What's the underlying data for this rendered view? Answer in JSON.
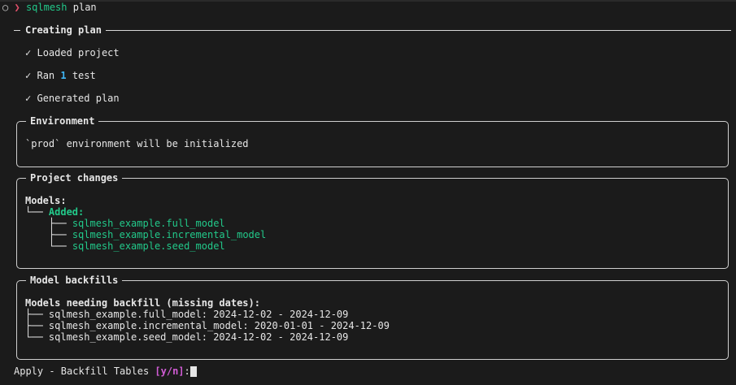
{
  "prompt": {
    "symbol": "○",
    "arrow": "❯",
    "command": "sqlmesh",
    "args": " plan"
  },
  "creating_plan": {
    "title": "Creating plan",
    "check": "✓",
    "items": [
      {
        "pre": "Loaded project",
        "num": "",
        "post": ""
      },
      {
        "pre": "Ran ",
        "num": "1",
        "post": " test"
      },
      {
        "pre": "Generated plan",
        "num": "",
        "post": ""
      }
    ]
  },
  "environment": {
    "title": "Environment",
    "message": "`prod` environment will be initialized"
  },
  "project_changes": {
    "title": "Project changes",
    "models_label": "Models:",
    "added_label": "Added:",
    "added_branch": "└── ",
    "added_models": [
      {
        "branch": "├── ",
        "name": "sqlmesh_example.full_model"
      },
      {
        "branch": "├── ",
        "name": "sqlmesh_example.incremental_model"
      },
      {
        "branch": "└── ",
        "name": "sqlmesh_example.seed_model"
      }
    ]
  },
  "model_backfills": {
    "title": "Model backfills",
    "heading": "Models needing backfill (missing dates):",
    "rows": [
      {
        "branch": "├── ",
        "text": "sqlmesh_example.full_model: 2024-12-02 - 2024-12-09"
      },
      {
        "branch": "├── ",
        "text": "sqlmesh_example.incremental_model: 2020-01-01 - 2024-12-09"
      },
      {
        "branch": "└── ",
        "text": "sqlmesh_example.seed_model: 2024-12-02 - 2024-12-09"
      }
    ]
  },
  "apply_prompt": {
    "text": "Apply - Backfill Tables ",
    "options": "[y/n]",
    "suffix": ": "
  }
}
